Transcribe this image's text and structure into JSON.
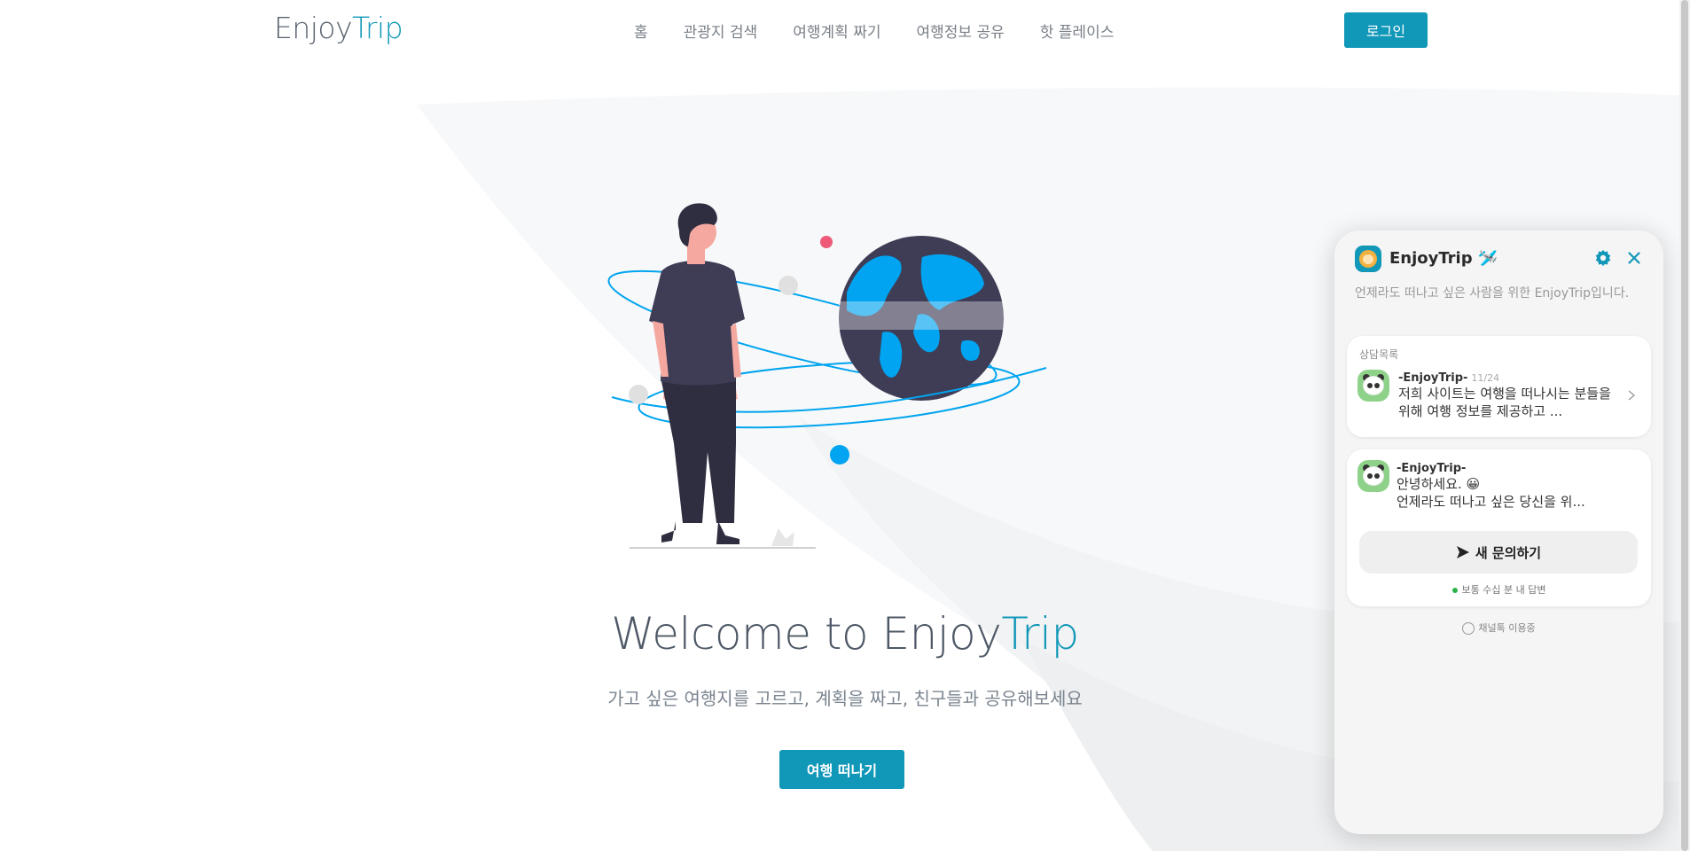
{
  "header": {
    "logo_part1": "Enjoy",
    "logo_part2": "Trip",
    "nav": [
      "홈",
      "관광지 검색",
      "여행계획 짜기",
      "여행정보 공유",
      "핫 플레이스"
    ],
    "login_label": "로그인"
  },
  "hero": {
    "title_part1": "Welcome to Enjoy",
    "title_part2": "Trip",
    "subtitle": "가고 싶은 여행지를 고르고, 계획을 짜고, 친구들과 공유해보세요",
    "cta_label": "여행 떠나기"
  },
  "chat": {
    "title": "EnjoyTrip",
    "title_emoji": "🛩️",
    "description": "언제라도 떠나고 싶은 사람을 위한 EnjoyTrip입니다.",
    "history_label": "상담목록",
    "history": {
      "sender": "-EnjoyTrip-",
      "date": "11/24",
      "message": "저희 사이트는 여행을 떠나시는 분들을 위해 여행 정보를 제공하고 ..."
    },
    "greeting": {
      "sender": "-EnjoyTrip-",
      "line1": "안녕하세요. 😀",
      "line2": "언제라도 떠나고 싶은 당신을 위..."
    },
    "new_inquiry_label": "새 문의하기",
    "reply_time": "보통 수십 분 내 답변",
    "powered_by": "채널톡 이용중"
  },
  "icons": [
    "settings-gear-icon",
    "close-icon",
    "chevron-right-icon",
    "send-icon",
    "panda-avatar-icon",
    "lion-avatar-icon"
  ],
  "colors": {
    "accent": "#1197b8",
    "illustration_blue": "#00a4f0",
    "illustration_dark": "#3f3d56",
    "pink_dot": "#ee5a78"
  }
}
